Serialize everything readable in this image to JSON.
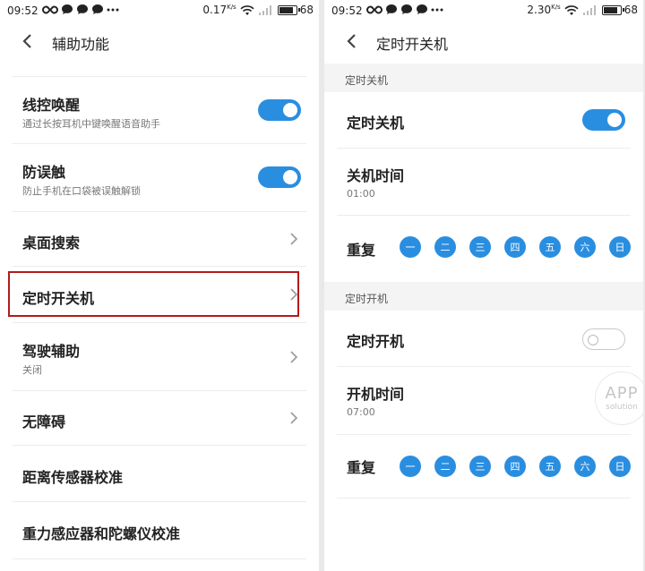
{
  "left": {
    "status": {
      "time": "09:52",
      "speed_value": "0.17",
      "speed_unit": "K/s",
      "battery": "68"
    },
    "header": {
      "title": "辅助功能"
    },
    "items": [
      {
        "label": "线控唤醒",
        "sub": "通过长按耳机中键唤醒语音助手",
        "control": "toggle",
        "state": "on"
      },
      {
        "label": "防误触",
        "sub": "防止手机在口袋被误触解锁",
        "control": "toggle",
        "state": "on"
      },
      {
        "label": "桌面搜索",
        "sub": "",
        "control": "chevron"
      },
      {
        "label": "定时开关机",
        "sub": "",
        "control": "chevron",
        "highlighted": true
      },
      {
        "label": "驾驶辅助",
        "sub": "关闭",
        "control": "chevron"
      },
      {
        "label": "无障碍",
        "sub": "",
        "control": "chevron"
      },
      {
        "label": "距离传感器校准",
        "sub": "",
        "control": "none"
      },
      {
        "label": "重力感应器和陀螺仪校准",
        "sub": "",
        "control": "none"
      }
    ]
  },
  "right": {
    "status": {
      "time": "09:52",
      "speed_value": "2.30",
      "speed_unit": "K/s",
      "battery": "68"
    },
    "header": {
      "title": "定时开关机"
    },
    "shutdown": {
      "section": "定时关机",
      "toggle_label": "定时关机",
      "toggle_state": "on",
      "time_label": "关机时间",
      "time_value": "01:00",
      "repeat_label": "重复"
    },
    "startup": {
      "section": "定时开机",
      "toggle_label": "定时开机",
      "toggle_state": "off",
      "time_label": "开机时间",
      "time_value": "07:00",
      "repeat_label": "重复"
    },
    "days": [
      "一",
      "二",
      "三",
      "四",
      "五",
      "六",
      "日"
    ]
  },
  "watermark": {
    "line1": "APP",
    "line2": "solution"
  },
  "colors": {
    "accent": "#2a8ee0",
    "highlight": "#b11b1b"
  },
  "icons": [
    "infinity-icon",
    "chat-bubble-icon",
    "more-dots-icon",
    "wifi-icon",
    "signal-icon",
    "battery-icon",
    "back-arrow-icon",
    "chevron-right-icon"
  ]
}
